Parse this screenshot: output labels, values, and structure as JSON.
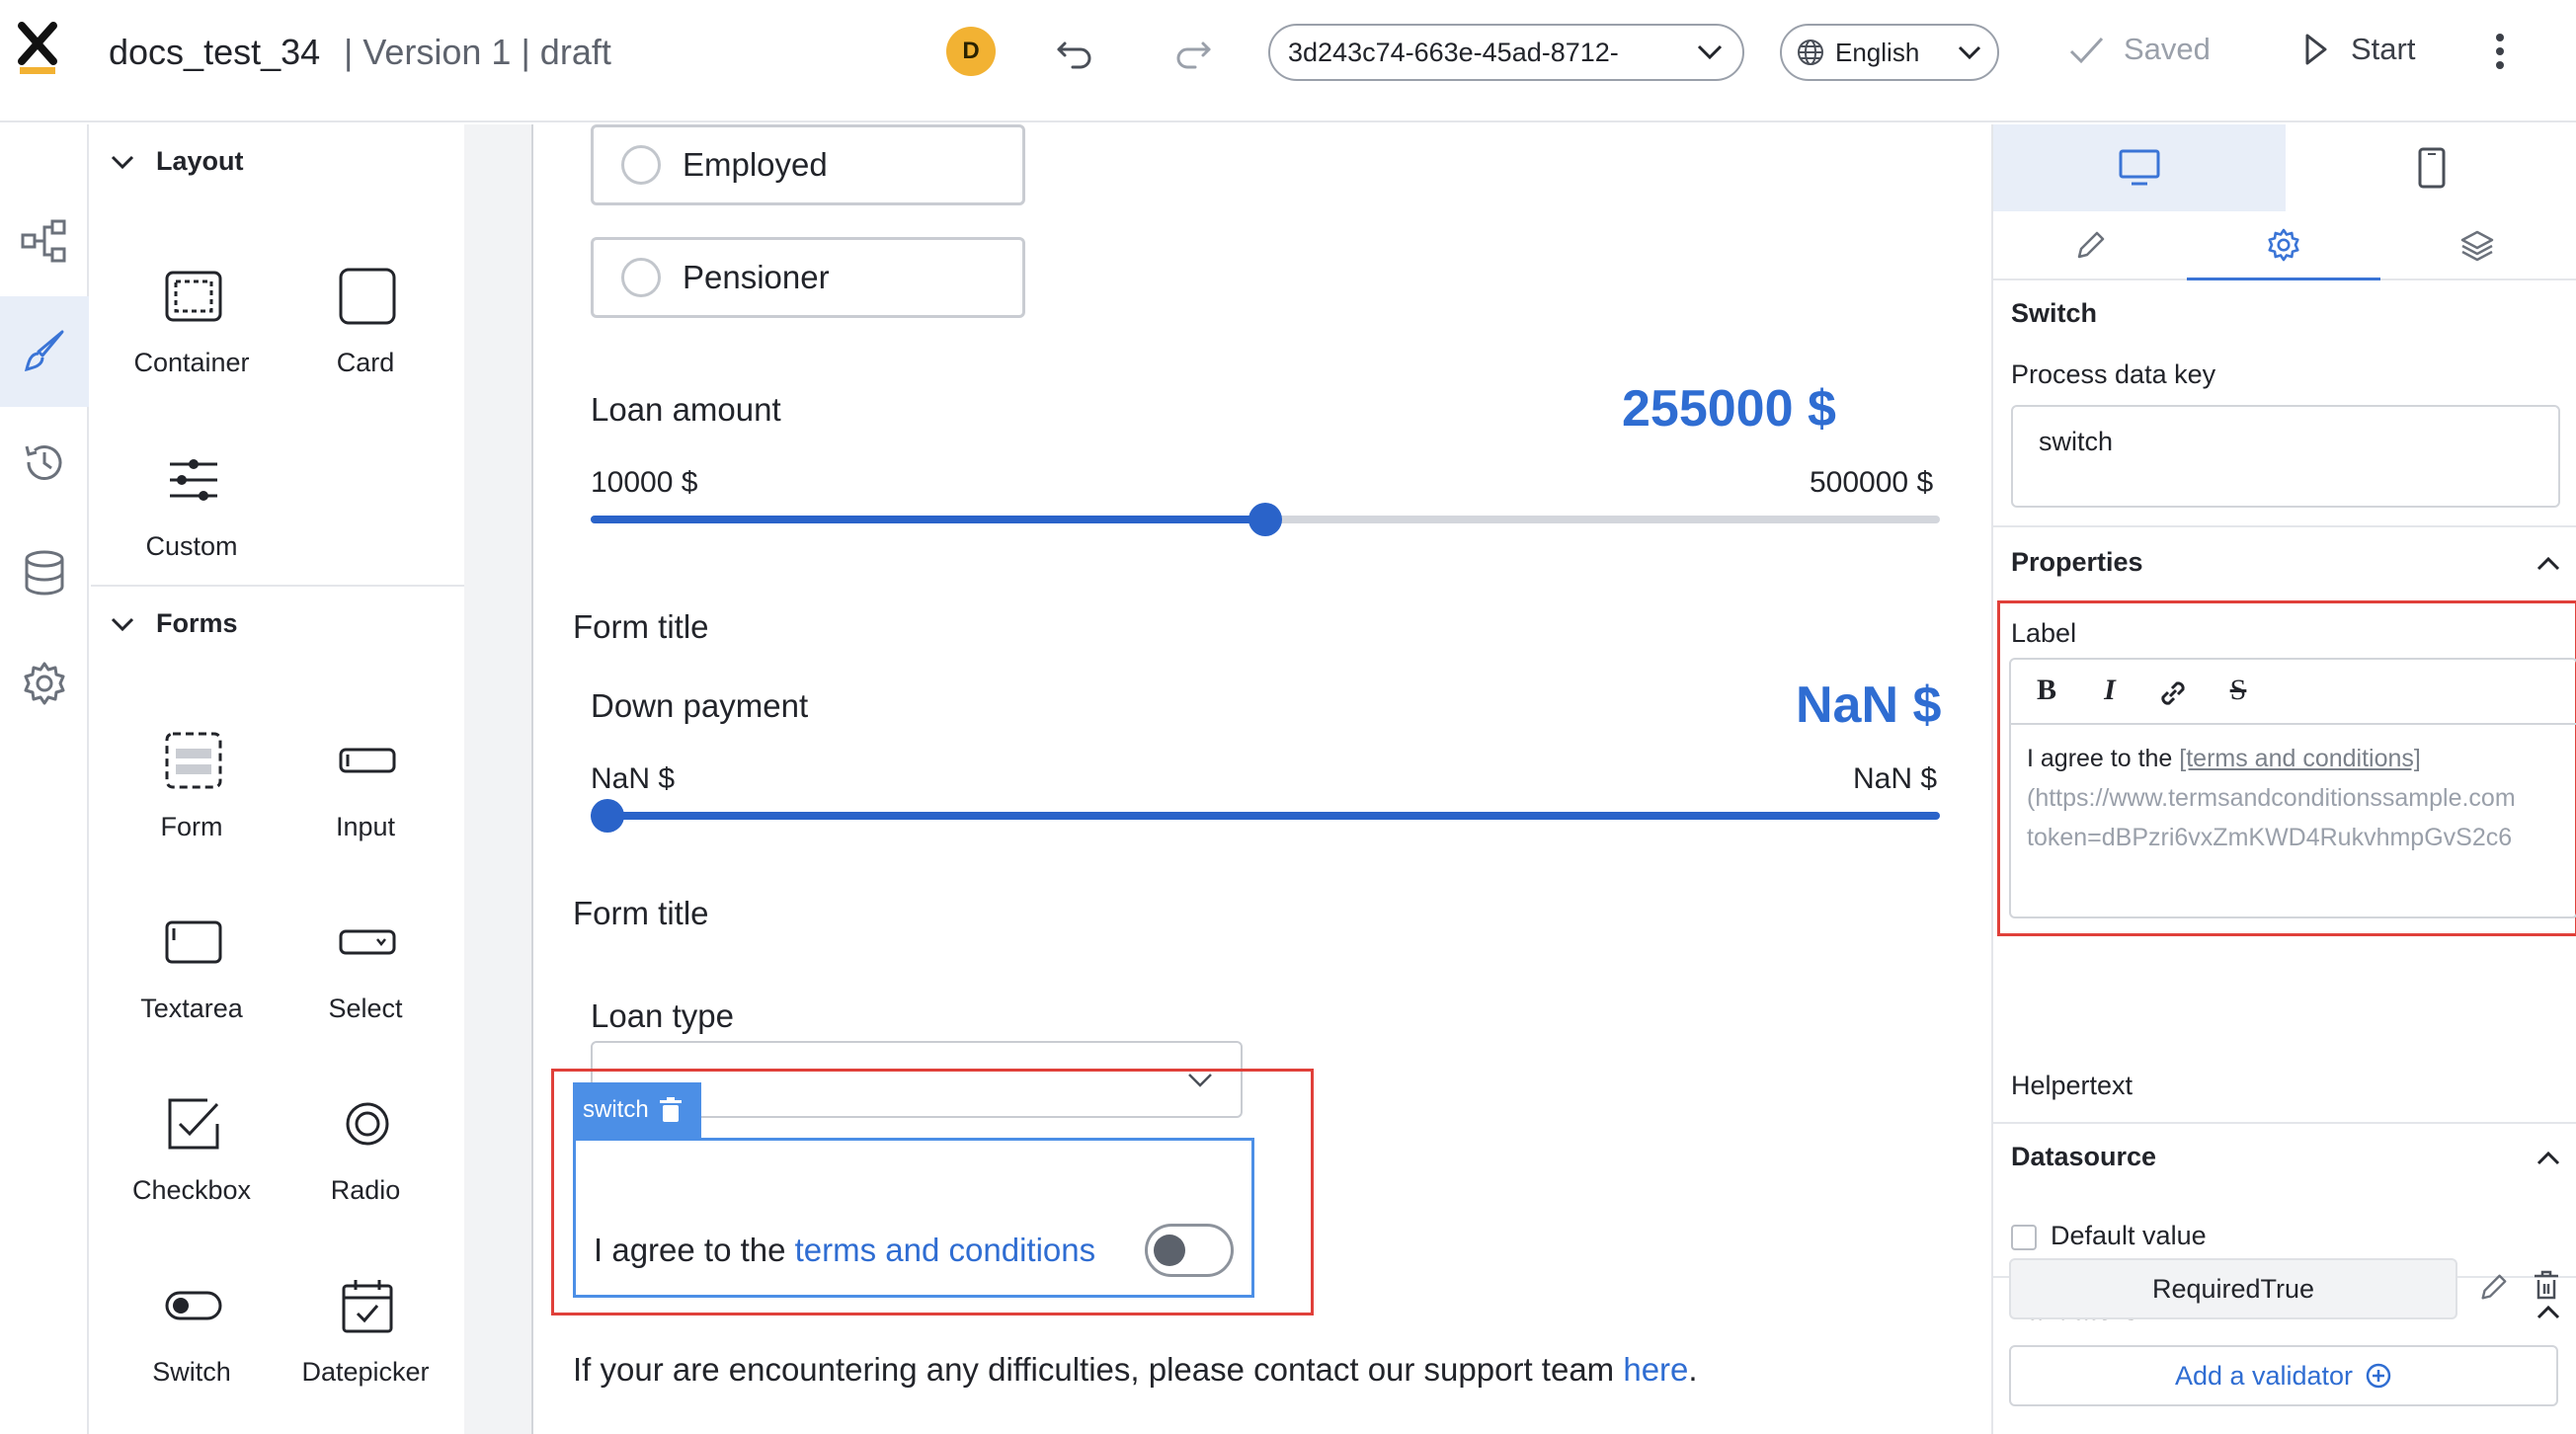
{
  "header": {
    "doc_name": "docs_test_34",
    "doc_meta": " | Version 1 | draft",
    "avatar_initial": "D",
    "process_id": "3d243c74-663e-45ad-8712-",
    "language": "English",
    "saved_label": "Saved",
    "start_label": "Start"
  },
  "palette": {
    "layout_header": "Layout",
    "forms_header": "Forms",
    "layout_items": [
      {
        "label": "Container",
        "icon": "container-icon"
      },
      {
        "label": "Card",
        "icon": "card-icon"
      },
      {
        "label": "Custom",
        "icon": "custom-icon"
      }
    ],
    "form_items": [
      {
        "label": "Form",
        "icon": "form-icon"
      },
      {
        "label": "Input",
        "icon": "input-icon"
      },
      {
        "label": "Textarea",
        "icon": "textarea-icon"
      },
      {
        "label": "Select",
        "icon": "select-icon"
      },
      {
        "label": "Checkbox",
        "icon": "checkbox-icon"
      },
      {
        "label": "Radio",
        "icon": "radio-icon"
      },
      {
        "label": "Switch",
        "icon": "switch-icon"
      },
      {
        "label": "Datepicker",
        "icon": "datepicker-icon"
      }
    ]
  },
  "canvas": {
    "radio_options": [
      "Employed",
      "Pensioner"
    ],
    "loan_amount": {
      "label": "Loan amount",
      "value": "255000 $",
      "min": "10000 $",
      "max": "500000 $",
      "fraction": 0.5
    },
    "form_title_1": "Form title",
    "down_payment": {
      "label": "Down payment",
      "value": "NaN $",
      "min": "NaN $",
      "max": "NaN $",
      "fraction": 0
    },
    "form_title_2": "Form title",
    "loan_type_label": "Loan type",
    "switch_tag": "switch",
    "switch_label_prefix": "I agree to the ",
    "switch_label_link": "terms and conditions",
    "support_prefix": "If your are encountering any difficulties, please contact our support team ",
    "support_link": "here",
    "support_suffix": "."
  },
  "right_panel": {
    "component_title": "Switch",
    "process_data_key_label": "Process data key",
    "process_data_key_value": "switch",
    "properties_title": "Properties",
    "label_title": "Label",
    "editor_tools": [
      "B",
      "I",
      "link",
      "S"
    ],
    "label_text_plain": "I agree to the ",
    "label_text_link": "[terms and conditions]",
    "label_text_url_1": "(https://www.termsandconditionssample.com",
    "label_text_url_2": "token=dBPzri6vxZmKWD4RukvhmpGvS2c6",
    "helpertext_title": "Helpertext",
    "datasource_title": "Datasource",
    "default_value_label": "Default value",
    "validators_title": "Validators",
    "validator_chip": "RequiredTrue",
    "add_validator_label": "Add a validator"
  },
  "colors": {
    "accent": "#2f6dd2",
    "selection_blue": "#4c8fe6",
    "highlight_red": "#e0403a",
    "avatar": "#f2b233"
  }
}
